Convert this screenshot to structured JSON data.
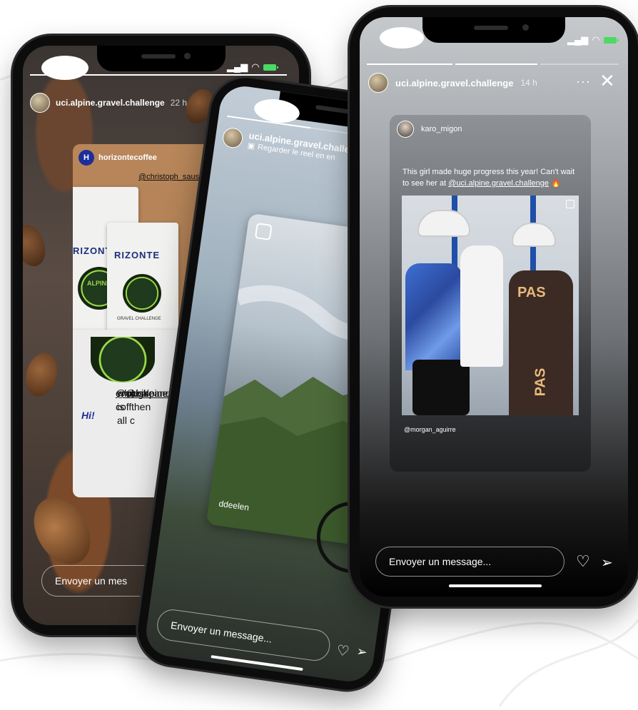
{
  "phone_left": {
    "account": "uci.alpine.gravel.challenge",
    "time": "22 h",
    "shared_post": {
      "author": "horizontecoffee",
      "author_initial": "H",
      "mention": "@christoph_sauser",
      "bag_brand": "RIZONTE",
      "bag_brand_2": "RIZONTE",
      "bag_label": "ALPINE",
      "bag_sublabel": "GRAVEL CHALLENGE",
      "lines": [
        "@uci.alpine.gr",
        "@bikeands",
        "less then",
        "who is all c",
        "enough coff"
      ],
      "hi_badge": "Hi!"
    },
    "message_placeholder": "Envoyer un mes"
  },
  "phone_middle": {
    "account": "uci.alpine.gravel.challe",
    "subtitle": "Regarder le reel en en",
    "reel_author": "ddeelen",
    "message_placeholder": "Envoyer un message..."
  },
  "phone_right": {
    "account": "uci.alpine.gravel.challenge",
    "time": "14 h",
    "repost": {
      "author": "karo_migon",
      "caption_start": "This girl made huge progress this year! Can't wait to see her at ",
      "caption_mention": "@uci.alpine.gravel.challenge",
      "caption_emoji": "🔥",
      "photo_credit": "@morgan_aguirre",
      "jersey_text_1": "PAS",
      "jersey_text_2": "PAS"
    },
    "message_placeholder": "Envoyer un message..."
  },
  "icons": {
    "heart": "heart-icon",
    "send": "send-icon",
    "more": "more-icon",
    "close": "close-icon",
    "reel": "reel-icon"
  },
  "colors": {
    "battery": "#4cd964",
    "coffee_brand": "#1c2e7a",
    "accent_green": "#9bd94a"
  }
}
